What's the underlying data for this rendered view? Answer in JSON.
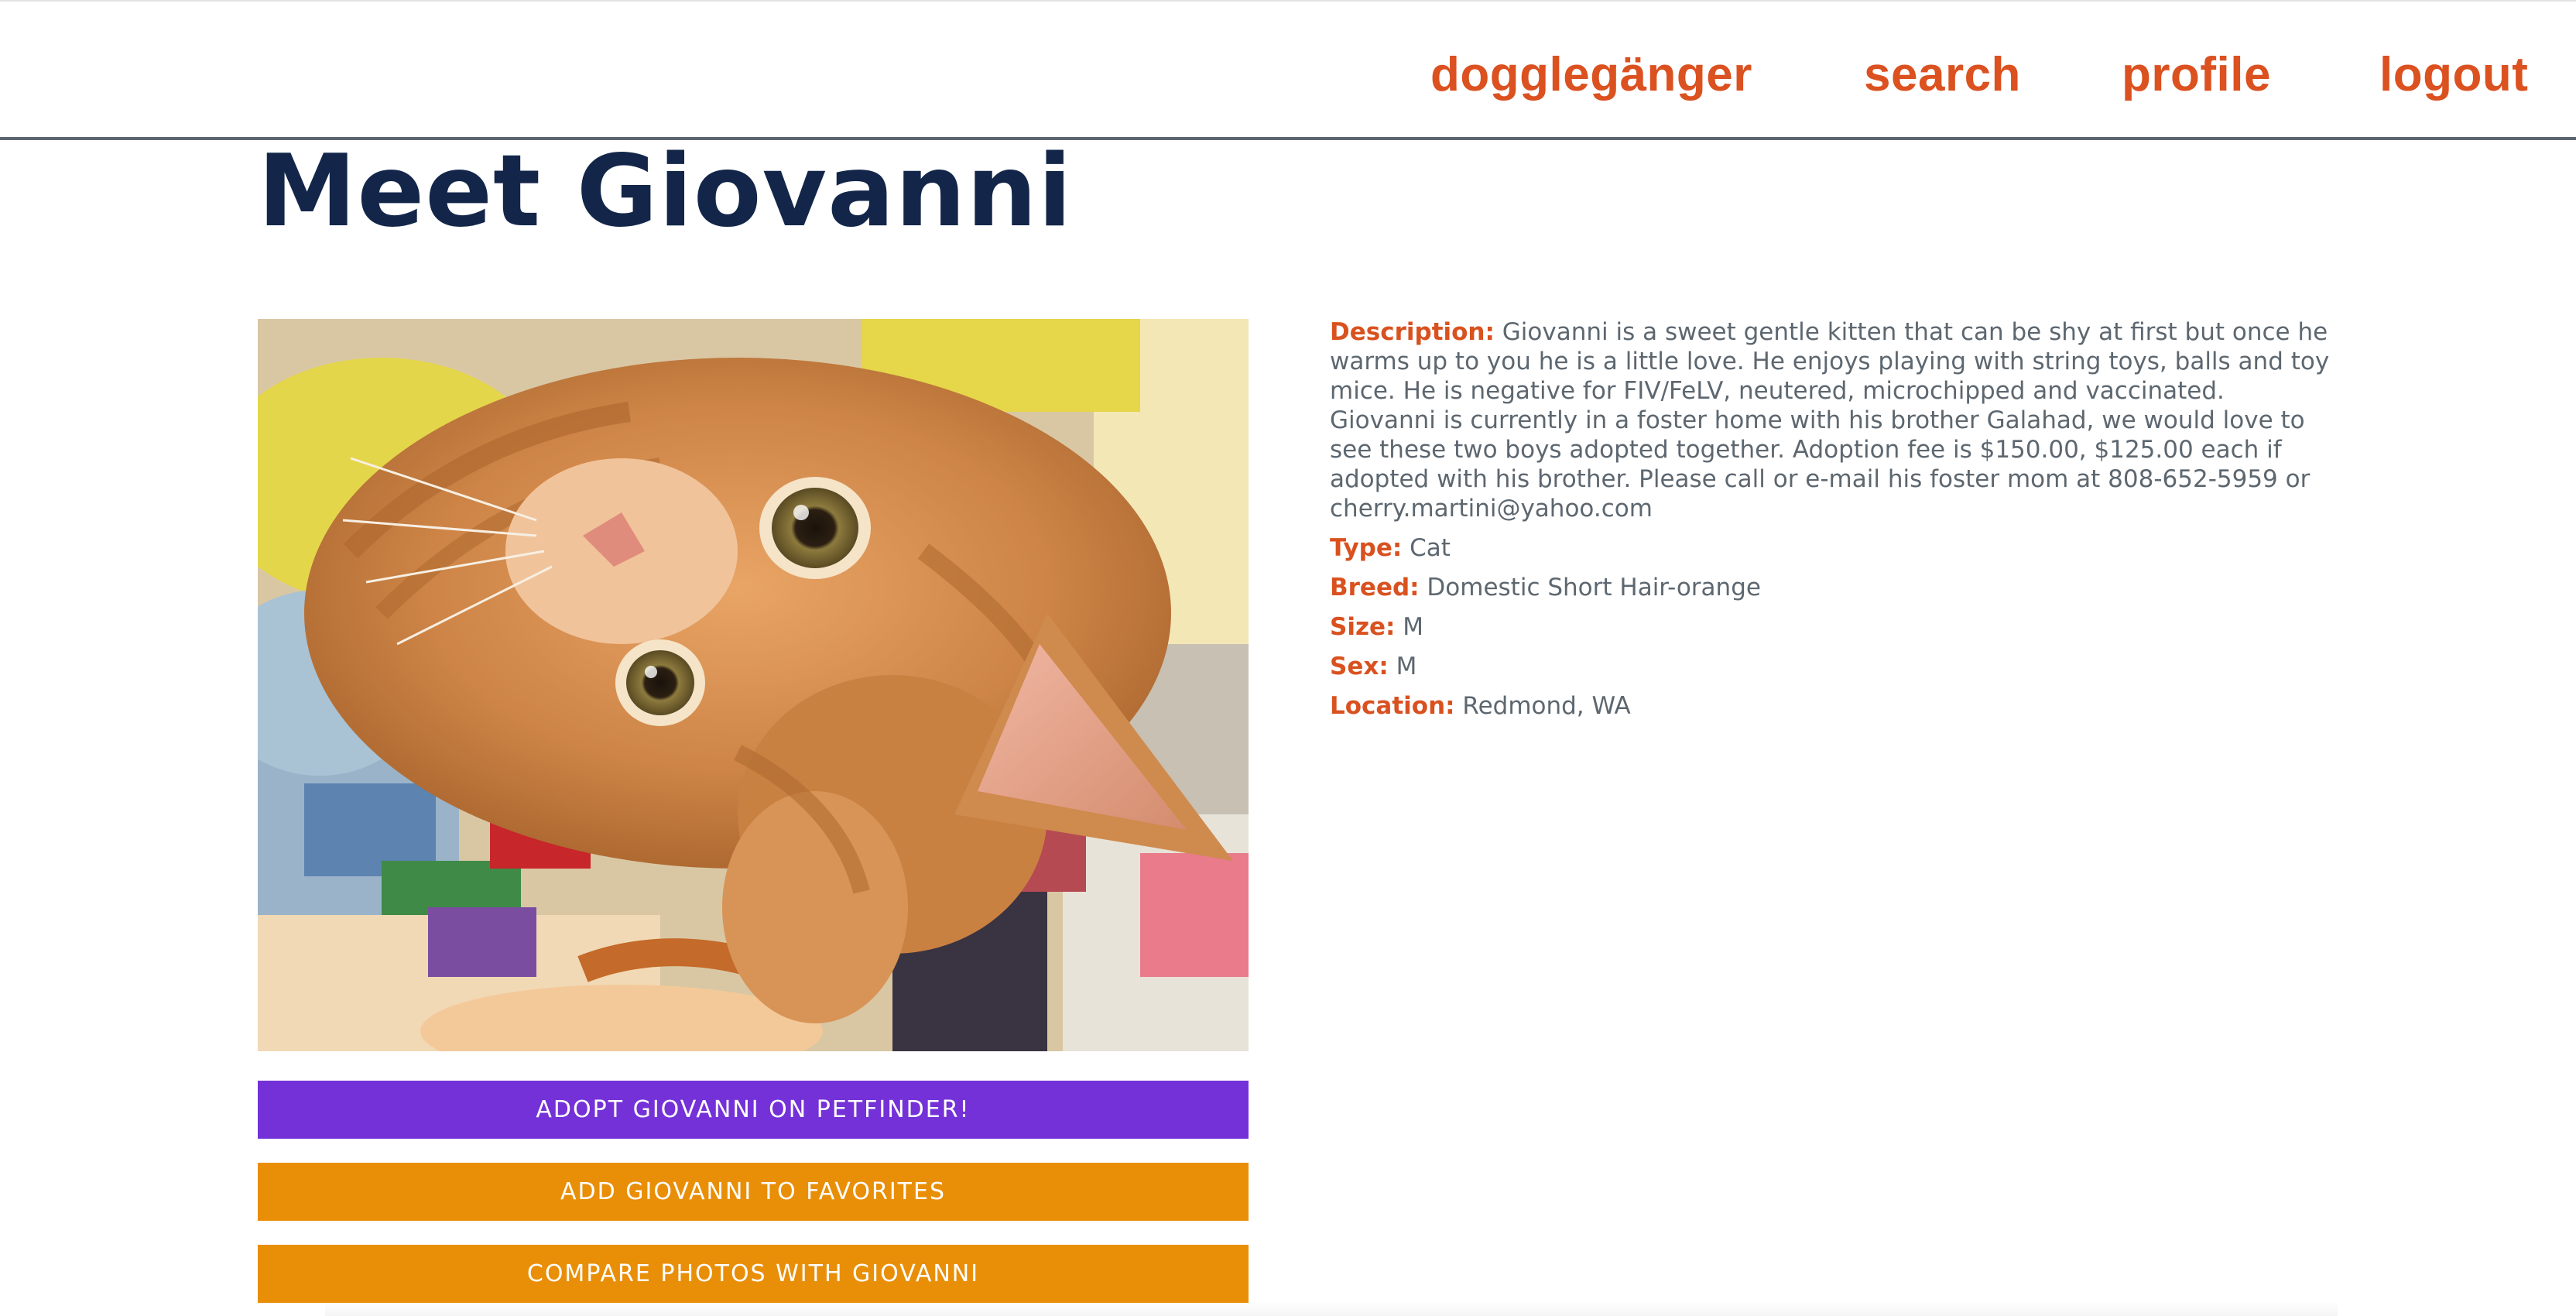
{
  "nav": {
    "brand": "dogglegänger",
    "search": "search",
    "profile": "profile",
    "logout": "logout"
  },
  "page": {
    "title": "Meet Giovanni"
  },
  "photo": {
    "alt": "Giovanni",
    "subject": "orange tabby kitten lying upside down on a patchwork quilt"
  },
  "buttons": {
    "adopt": "ADOPT GIOVANNI ON PETFINDER!",
    "favorite": "ADD GIOVANNI TO FAVORITES",
    "compare": "COMPARE PHOTOS WITH GIOVANNI"
  },
  "details": {
    "description_label": "Description:",
    "description": "Giovanni is a sweet gentle kitten that can be shy at first but once he warms up to you he is a little love. He enjoys playing with string toys, balls and toy mice. He is negative for FIV/FeLV, neutered, microchipped and vaccinated. Giovanni is currently in a foster home with his brother Galahad, we would love to see these two boys adopted together. Adoption fee is $150.00, $125.00 each if adopted with his brother. Please call or e-mail his foster mom at 808-652-5959 or cherry.martini@yahoo.com",
    "type_label": "Type:",
    "type": "Cat",
    "breed_label": "Breed:",
    "breed": "Domestic Short Hair-orange",
    "size_label": "Size:",
    "size": "M",
    "sex_label": "Sex:",
    "sex": "M",
    "location_label": "Location:",
    "location": "Redmond, WA"
  },
  "colors": {
    "nav_accent": "#db5120",
    "title": "#13264a",
    "adopt_button": "#7431d8",
    "secondary_button": "#e98e07",
    "label": "#d9511f",
    "body_text": "#5d6770"
  }
}
